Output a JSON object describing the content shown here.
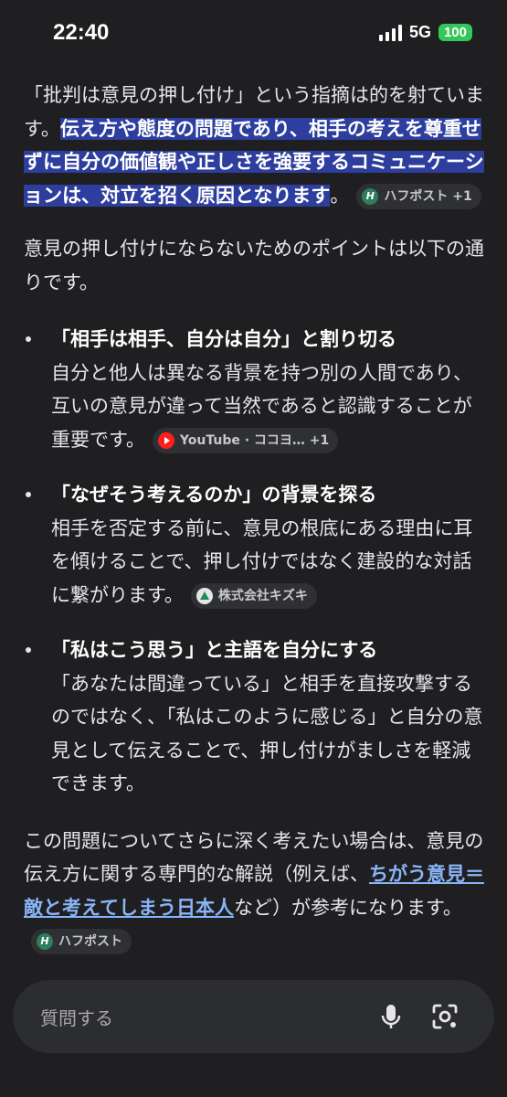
{
  "status_bar": {
    "time": "22:40",
    "network": "5G",
    "battery": "100"
  },
  "para1": {
    "text_plain": "「批判は意見の押し付け」という指摘は的を射ています。",
    "text_highlight": "伝え方や態度の問題であり、相手の考えを尊重せずに自分の価値観や正しさを強要するコミュニケーションは、対立を招く原因となります",
    "text_end": "。",
    "chip": "ハフポスト +1",
    "chip_icon": "h-icon"
  },
  "para2": {
    "text": "意見の押し付けにならないためのポイントは以下の通りです。"
  },
  "points": [
    {
      "title": "「相手は相手、自分は自分」と割り切る",
      "body": "自分と他人は異なる背景を持つ別の人間であり、互いの意見が違って当然であると認識することが重要です。",
      "chip": "YouTube · ココヨ… +1",
      "chip_icon": "youtube-icon"
    },
    {
      "title": "「なぜそう考えるのか」の背景を探る",
      "body": "相手を否定する前に、意見の根底にある理由に耳を傾けることで、押し付けではなく建設的な対話に繋がります。",
      "chip": "株式会社キズキ",
      "chip_icon": "kizuki-icon"
    },
    {
      "title": "「私はこう思う」と主語を自分にする",
      "body": "「あなたは間違っている」と相手を直接攻撃するのではなく、「私はこのように感じる」と自分の意見として伝えることで、押し付けがましさを軽減できます。"
    }
  ],
  "para3": {
    "before": "この問題についてさらに深く考えたい場合は、意見の伝え方に関する専門的な解説（例えば、",
    "link": "ちがう意見＝敵と考えてしまう日本人",
    "after": "など）が参考になります。",
    "chip": "ハフポスト",
    "chip_icon": "h-icon"
  },
  "input": {
    "placeholder": "質問する"
  },
  "colors": {
    "background": "#1f1f21",
    "highlight": "#2d3e9e",
    "link": "#8ab4f8",
    "battery": "#34c759"
  }
}
